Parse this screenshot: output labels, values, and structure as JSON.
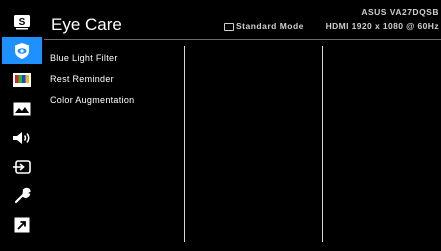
{
  "header": {
    "title": "Eye Care",
    "model": "ASUS VA27DQSB",
    "mode": "Standard Mode",
    "signal": "HDMI 1920 x 1080 @ 60Hz"
  },
  "sidebar": {
    "items": [
      {
        "icon": "splendid-s-icon"
      },
      {
        "icon": "eye-care-icon",
        "active": true
      },
      {
        "icon": "color-bars-icon"
      },
      {
        "icon": "image-icon"
      },
      {
        "icon": "sound-icon"
      },
      {
        "icon": "input-select-icon"
      },
      {
        "icon": "system-setup-icon"
      },
      {
        "icon": "shortcut-icon"
      }
    ]
  },
  "menu": {
    "items": [
      {
        "label": "Blue Light Filter"
      },
      {
        "label": "Rest Reminder"
      },
      {
        "label": "Color Augmentation"
      }
    ]
  },
  "colors": {
    "accent": "#1e90ff",
    "background": "#000000"
  }
}
